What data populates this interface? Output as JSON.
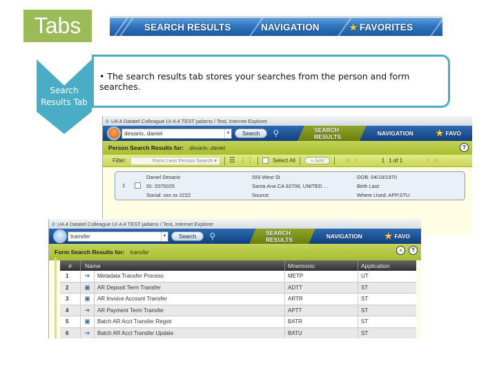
{
  "slide": {
    "title": "Tabs",
    "chevron_label_line1": "Search",
    "chevron_label_line2": "Results Tab",
    "bullet": "The search results tab stores your searches from the person and form searches."
  },
  "banner": {
    "tabs": [
      "SEARCH RESULTS",
      "NAVIGATION",
      "FAVORITES"
    ]
  },
  "person_screen": {
    "window_title": "U4.4   Datatel Colleague UI 4.4   TEST   jadams / Test,   Internet Explorer",
    "search_value": "desario, daniel",
    "search_button": "Search",
    "tabs": [
      "SEARCH RESULTS",
      "NAVIGATION",
      "FAVO"
    ],
    "results_label": "Person Search Results for:",
    "results_query": "desario, daniel",
    "filter_label": "Filter:",
    "filter_value": "Form Less Person Search",
    "select_all": "Select All",
    "add_button": "+ Add",
    "page_current": "1",
    "page_of": "1 of 1",
    "result": {
      "index": "1",
      "name": "Daniel Desario",
      "id": "ID: 2075025",
      "social": "Social: xxx xx 2222",
      "address1": "555 West St",
      "address2": "Santa Ana CA 92706, UNITED ...",
      "source": "Source:",
      "dob": "DOB: 04/19/1970",
      "birth_last": "Birth Last:",
      "where_used": "Where Used: APP,STU"
    }
  },
  "form_screen": {
    "window_title": "U4.4   Datatel Colleague UI 4.4   TEST   jadams / Test,   Internet Explorer",
    "search_value": "transfer",
    "search_button": "Search",
    "tabs": [
      "SEARCH RESULTS",
      "NAVIGATION",
      "FAVO"
    ],
    "results_label": "Form Search Results for:",
    "results_query": "transfer",
    "columns": [
      "#",
      "Name",
      "Mnemonic",
      "Application"
    ],
    "rows": [
      {
        "num": "1",
        "icon": "process-icon",
        "name": "Metadata Transfer Process",
        "mnemonic": "METP",
        "app": "UT"
      },
      {
        "num": "2",
        "icon": "form-icon",
        "name": "AR Deposit Term Transfer",
        "mnemonic": "ADTT",
        "app": "ST"
      },
      {
        "num": "3",
        "icon": "form-icon",
        "name": "AR Invoice Account Transfer",
        "mnemonic": "ARTR",
        "app": "ST"
      },
      {
        "num": "4",
        "icon": "process-icon",
        "name": "AR Payment Term Transfer",
        "mnemonic": "APTT",
        "app": "ST"
      },
      {
        "num": "5",
        "icon": "form-icon",
        "name": "Batch AR Acct Transfer Regstr",
        "mnemonic": "BATR",
        "app": "ST"
      },
      {
        "num": "6",
        "icon": "process-icon",
        "name": "Batch AR Acct Transfer Update",
        "mnemonic": "BATU",
        "app": "ST"
      }
    ]
  }
}
